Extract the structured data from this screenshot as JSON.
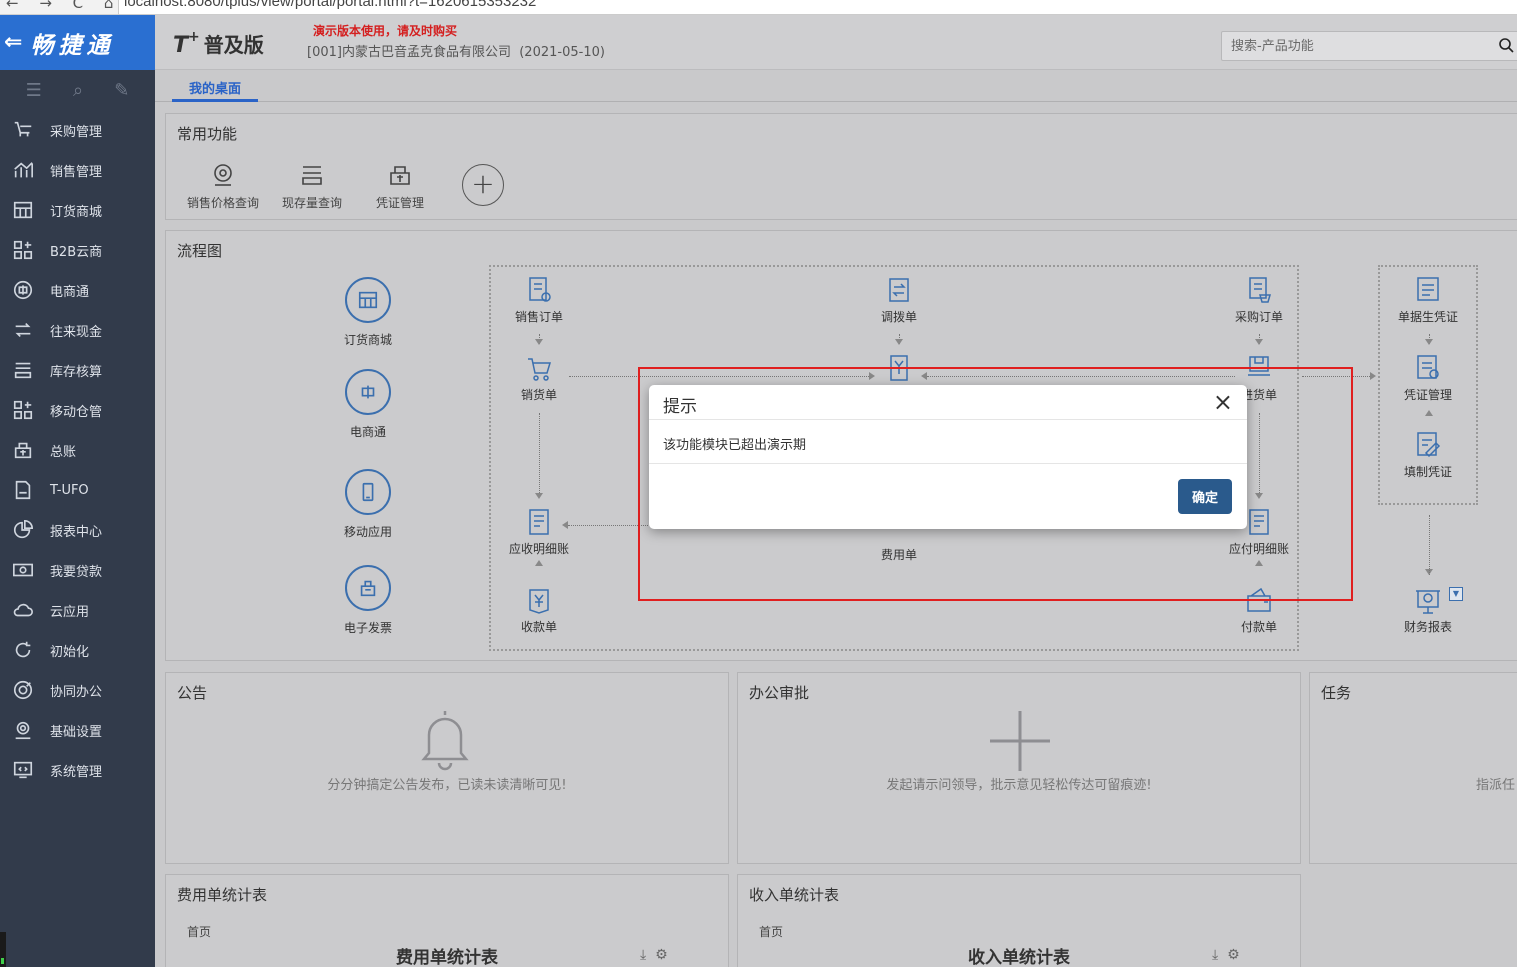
{
  "browser": {
    "url": "localhost:8080/tplus/view/portal/portal.html?t=1620615353232"
  },
  "sidebar": {
    "brand": "畅捷通",
    "items": [
      {
        "label": "采购管理",
        "icon": "cart-icon"
      },
      {
        "label": "销售管理",
        "icon": "chart-icon"
      },
      {
        "label": "订货商城",
        "icon": "store-icon"
      },
      {
        "label": "B2B云商",
        "icon": "grid-icon"
      },
      {
        "label": "电商通",
        "icon": "ecommerce-icon"
      },
      {
        "label": "往来现金",
        "icon": "exchange-icon"
      },
      {
        "label": "库存核算",
        "icon": "inventory-icon"
      },
      {
        "label": "移动仓管",
        "icon": "mobile-warehouse-icon"
      },
      {
        "label": "总账",
        "icon": "ledger-icon"
      },
      {
        "label": "T-UFO",
        "icon": "ufo-icon"
      },
      {
        "label": "报表中心",
        "icon": "pie-icon"
      },
      {
        "label": "我要贷款",
        "icon": "money-icon"
      },
      {
        "label": "云应用",
        "icon": "cloud-icon"
      },
      {
        "label": "初始化",
        "icon": "refresh-icon"
      },
      {
        "label": "协同办公",
        "icon": "collab-icon"
      },
      {
        "label": "基础设置",
        "icon": "settings-icon"
      },
      {
        "label": "系统管理",
        "icon": "system-icon"
      }
    ]
  },
  "header": {
    "logo": "T",
    "logo_plus": "+",
    "edition": "普及版",
    "demo_warning": "演示版本使用，请及时购买",
    "company": "[001]内蒙古巴音孟克食品有限公司",
    "date": "(2021-05-10)",
    "search_placeholder": "搜索-产品功能"
  },
  "tabs": {
    "active": "我的桌面"
  },
  "common_functions": {
    "title": "常用功能",
    "items": [
      "销售价格查询",
      "现存量查询",
      "凭证管理"
    ]
  },
  "flowchart": {
    "title": "流程图",
    "left_items": [
      "订货商城",
      "电商通",
      "移动应用",
      "电子发票"
    ],
    "nodes": {
      "sales_order": "销售订单",
      "sales_delivery": "销货单",
      "ar_detail": "应收明细账",
      "receipt": "收款单",
      "transfer": "调拨单",
      "expense": "费用单",
      "purchase_order": "采购订单",
      "purchase_receipt": "进货单",
      "ap_detail": "应付明细账",
      "payment": "付款单",
      "voucher_gen": "单据生凭证",
      "voucher_mgmt": "凭证管理",
      "voucher_fill": "填制凭证",
      "fin_report": "财务报表"
    }
  },
  "notice": {
    "title": "公告",
    "empty": "分分钟搞定公告发布，已读未读清晰可见!"
  },
  "approval": {
    "title": "办公审批",
    "empty": "发起请示问领导，批示意见轻松传达可留痕迹!"
  },
  "task": {
    "title": "任务",
    "empty": "指派任"
  },
  "expense_stats": {
    "title": "费用单统计表",
    "sub": "首页",
    "heading": "费用单统计表"
  },
  "income_stats": {
    "title": "收入单统计表",
    "sub": "首页",
    "heading": "收入单统计表"
  },
  "modal": {
    "title": "提示",
    "message": "该功能模块已超出演示期",
    "ok": "确定",
    "close": "×"
  }
}
